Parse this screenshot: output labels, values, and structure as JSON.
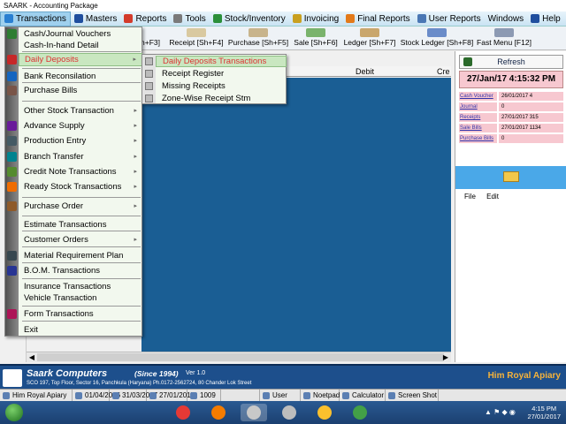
{
  "window": {
    "title": "SAARK - Accounting Package"
  },
  "menubar": [
    {
      "label": "Transactions",
      "color": "#2a7fd1",
      "active": true
    },
    {
      "label": "Masters",
      "color": "#1f4e9e"
    },
    {
      "label": "Reports",
      "color": "#d33b2c"
    },
    {
      "label": "Tools",
      "color": "#7a7a7a"
    },
    {
      "label": "Stock/Inventory",
      "color": "#2b8f3a"
    },
    {
      "label": "Invoicing",
      "color": "#c9a020"
    },
    {
      "label": "Final Reports",
      "color": "#e37a1a"
    },
    {
      "label": "User Reports",
      "color": "#4a77b4"
    },
    {
      "label": "Windows",
      "color": ""
    },
    {
      "label": "Help",
      "color": "#1f4e9e"
    }
  ],
  "toolbar": [
    {
      "label": "h+F3]",
      "color": ""
    },
    {
      "label": "Receipt [Sh+F4]",
      "color": "#d9c9a0"
    },
    {
      "label": "Purchase [Sh+F5]",
      "color": "#c8b48c"
    },
    {
      "label": "Sale [Sh+F6]",
      "color": "#7ab36c"
    },
    {
      "label": "Ledger [Sh+F7]",
      "color": "#c9a66c"
    },
    {
      "label": "Stock Ledger [Sh+F8]",
      "color": "#6a8cc9"
    },
    {
      "label": "Fast Menu [F12]",
      "color": "#8c9ab3"
    }
  ],
  "grid": {
    "debit": "Debit",
    "credit": "Cre"
  },
  "transactions_menu": [
    {
      "label": "Cash/Journal Vouchers",
      "icon": "cash-icon",
      "color": "#2e7d32"
    },
    {
      "label": "Cash-In-hand Detail",
      "icon": "",
      "color": ""
    },
    {
      "label": "Daily Deposits",
      "icon": "deposit-icon",
      "color": "#c62828",
      "highlight": true,
      "submenu": true
    },
    {
      "label": "Bank  Reconsilation",
      "icon": "bank-icon",
      "color": "#1565c0"
    },
    {
      "label": "Purchase Bills",
      "icon": "purchase-icon",
      "color": "#795548"
    },
    {
      "label": "Other Stock Transaction",
      "icon": "",
      "color": "",
      "submenu": true
    },
    {
      "label": "Advance Supply",
      "icon": "supply-icon",
      "color": "#6a1b9a",
      "submenu": true
    },
    {
      "label": "Production Entry",
      "icon": "production-icon",
      "color": "#455a64",
      "submenu": true
    },
    {
      "label": "Branch Transfer",
      "icon": "transfer-icon",
      "color": "#00838f",
      "submenu": true
    },
    {
      "label": "Credit Note Transactions",
      "icon": "credit-note-icon",
      "color": "#558b2f",
      "submenu": true
    },
    {
      "label": "Ready Stock Transactions",
      "icon": "stock-icon",
      "color": "#ef6c00",
      "submenu": true
    },
    {
      "label": "Purchase Order",
      "icon": "order-icon",
      "color": "#8e5a2a",
      "submenu": true
    },
    {
      "label": "Estimate Transactions",
      "icon": "",
      "color": ""
    },
    {
      "label": "Customer Orders",
      "icon": "",
      "color": "",
      "submenu": true
    },
    {
      "label": "Material Requirement Plan",
      "icon": "plan-icon",
      "color": "#37474f"
    },
    {
      "label": "B.O.M. Transactions",
      "icon": "bom-icon",
      "color": "#283593"
    },
    {
      "label": "Insurance Transactions",
      "icon": "",
      "color": ""
    },
    {
      "label": "Vehicle Transaction",
      "icon": "",
      "color": ""
    },
    {
      "label": "Form Transactions",
      "icon": "form-icon",
      "color": "#ad1457"
    },
    {
      "label": "Exit",
      "icon": "",
      "color": ""
    }
  ],
  "daily_deposits_submenu": [
    {
      "label": "Daily Deposits Transactions",
      "highlight": true
    },
    {
      "label": "Receipt Register"
    },
    {
      "label": "Missing Receipts"
    },
    {
      "label": "Zone-Wise Receipt Stm"
    }
  ],
  "right_panel": {
    "refresh": "Refresh",
    "datetime": "27/Jan/17 4:15:32 PM",
    "stats": [
      {
        "label": "Cash Voucher",
        "value": "26/01/2017 4"
      },
      {
        "label": "Journal",
        "value": "0"
      },
      {
        "label": "Receipts",
        "value": "27/01/2017 315"
      },
      {
        "label": "Sale Bills",
        "value": "27/01/2017 1134"
      },
      {
        "label": "Purchase Bills",
        "value": "0"
      }
    ],
    "menu": [
      "File",
      "Edit"
    ]
  },
  "company": {
    "name": "Saark Computers",
    "since": "(Since 1994)",
    "version": "Ver 1.0",
    "address": "SCO 197, Top Floor, Sector 16, Panchkula (Haryana) Ph.0172-2562724,  80 Chander Lok Street",
    "client": "Him Royal Apiary"
  },
  "infobar": [
    {
      "label": "Him Royal Apiary",
      "icon": "firm-icon"
    },
    {
      "label": "01/04/2016",
      "icon": "calendar-icon"
    },
    {
      "label": "31/03/2017",
      "icon": "calendar-icon"
    },
    {
      "label": "27/01/2017",
      "icon": "calendar-icon"
    },
    {
      "label": "1009",
      "icon": "user-count-icon"
    },
    {
      "label": "",
      "icon": ""
    },
    {
      "label": "User",
      "icon": "user-icon"
    },
    {
      "label": "Noetpad",
      "icon": "notepad-icon"
    },
    {
      "label": "Calculator",
      "icon": "calculator-icon"
    },
    {
      "label": "Screen Shot",
      "icon": "screenshot-icon"
    }
  ],
  "taskbar": {
    "time": "4:15 PM",
    "date": "27/01/2017",
    "apps": [
      {
        "name": "chrome",
        "color": "#e53935"
      },
      {
        "name": "firefox",
        "color": "#f57c00"
      },
      {
        "name": "saark",
        "color": "#c8c8c8"
      },
      {
        "name": "calculator",
        "color": "#bdbdbd"
      },
      {
        "name": "files",
        "color": "#fbc02d"
      },
      {
        "name": "chrome2",
        "color": "#43a047"
      }
    ]
  }
}
